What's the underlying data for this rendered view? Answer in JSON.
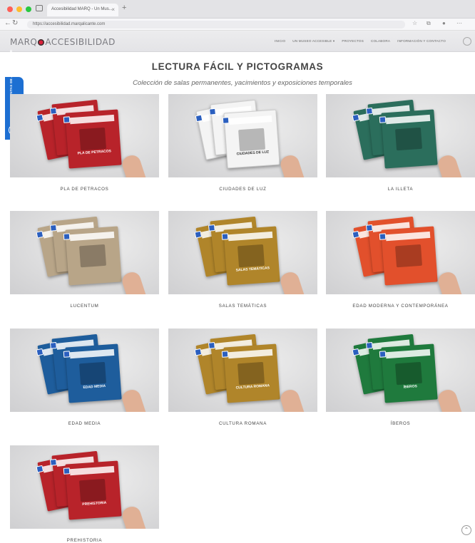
{
  "browser": {
    "tab_title": "Accesibilidad MARQ - Un Mus...",
    "url": "https://accesibilidad.marqalicante.com",
    "new_tab": "+",
    "close_tab": "×",
    "back": "←",
    "forward": "→",
    "reload": "↻"
  },
  "site": {
    "logo_left": "MARQ",
    "logo_right": "ACCESIBILIDAD",
    "menu": [
      "INICIO",
      "UN MUSEO ACCESIBLE ▾",
      "PROYECTOS",
      "COLABORA",
      "INFORMACIÓN Y CONTACTO"
    ],
    "accessibility_tab": "HERRAMIENTAS DE ACCESIBILIDAD"
  },
  "page": {
    "title": "LECTURA FÁCIL Y PICTOGRAMAS",
    "subtitle": "Colección de salas permanentes, yacimientos y exposiciones temporales"
  },
  "cards": [
    {
      "label": "PLA DE PETRACOS",
      "color": "#b8232a",
      "cover_title": "PLA DE PETRACOS"
    },
    {
      "label": "CIUDADES DE LUZ",
      "color": "#f4f4f4",
      "cover_title": "CIUDADES DE LUZ"
    },
    {
      "label": "LA ILLETA",
      "color": "#2b6e5c",
      "cover_title": ""
    },
    {
      "label": "LUCENTUM",
      "color": "#b8a588",
      "cover_title": ""
    },
    {
      "label": "SALAS TEMÁTICAS",
      "color": "#b0852a",
      "cover_title": "SALAS TEMÁTICAS"
    },
    {
      "label": "EDAD MODERNA Y CONTEMPORÁNEA",
      "color": "#e2502c",
      "cover_title": ""
    },
    {
      "label": "EDAD MEDIA",
      "color": "#1e5d9c",
      "cover_title": "EDAD MEDIA"
    },
    {
      "label": "CULTURA ROMANA",
      "color": "#b0852a",
      "cover_title": "CULTURA ROMANA"
    },
    {
      "label": "ÍBEROS",
      "color": "#1f7a3d",
      "cover_title": "ÍBEROS"
    },
    {
      "label": "PREHISTORIA",
      "color": "#b8232a",
      "cover_title": "PREHISTORIA"
    }
  ],
  "scroll_top": "⌃"
}
